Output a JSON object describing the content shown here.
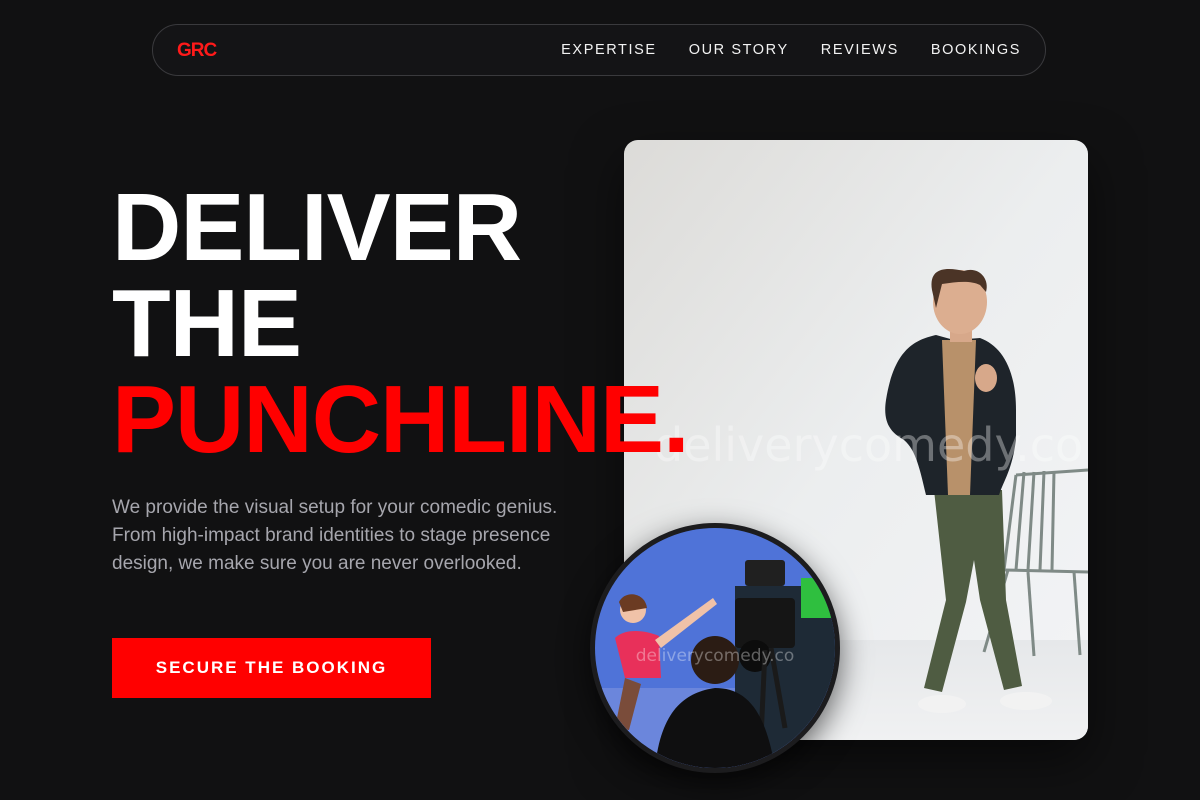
{
  "nav": {
    "logo": "GRC",
    "links": [
      "EXPERTISE",
      "OUR STORY",
      "REVIEWS",
      "BOOKINGS"
    ]
  },
  "hero": {
    "headline_line1": "DELIVER",
    "headline_line2": "THE",
    "headline_accent": "PUNCHLINE.",
    "description": "We provide the visual setup for your comedic genius. From high-impact brand identities to stage presence design, we make sure you are never overlooked.",
    "cta_label": "SECURE THE BOOKING"
  },
  "images": {
    "main_watermark": "deliverycomedy.co",
    "circle_watermark": "deliverycomedy.co"
  },
  "colors": {
    "background": "#111112",
    "accent": "#ff0000",
    "text": "#ffffff",
    "muted_text": "#a6a6ad"
  }
}
